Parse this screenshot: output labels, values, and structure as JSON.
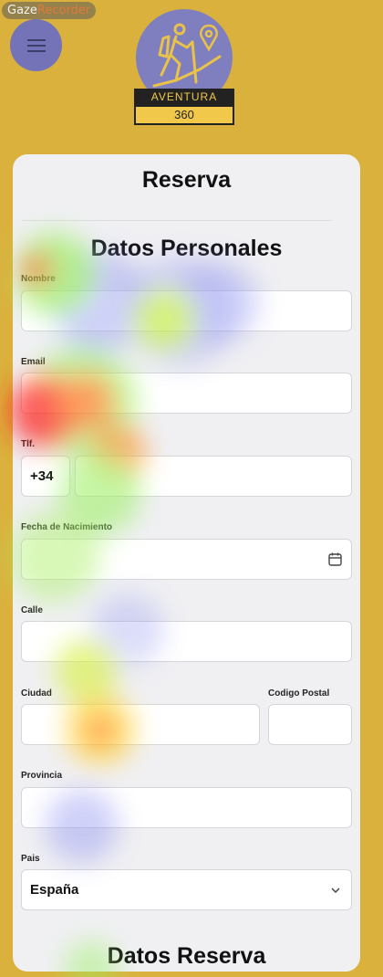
{
  "watermark": {
    "part1": "Gaze",
    "part2": "Recorder"
  },
  "logo": {
    "banner": "AVENTURA",
    "sub": "360"
  },
  "form": {
    "title": "Reserva",
    "section_personal": "Datos Personales",
    "section_booking": "Datos Reserva",
    "fields": {
      "nombre_label": "Nombre",
      "email_label": "Email",
      "tel_label": "Tlf.",
      "tel_prefix": "+34",
      "birth_label": "Fecha de Nacimiento",
      "street_label": "Calle",
      "city_label": "Ciudad",
      "zip_label": "Codigo Postal",
      "province_label": "Provincia",
      "country_label": "Pais",
      "country_value": "España"
    }
  },
  "colors": {
    "background": "#dbb13d",
    "menu_button": "#7473b8",
    "card": "#f0f0f3"
  },
  "icons": [
    "menu-icon",
    "hiker-icon",
    "location-pin-icon",
    "calendar-icon",
    "chevron-down-icon"
  ]
}
